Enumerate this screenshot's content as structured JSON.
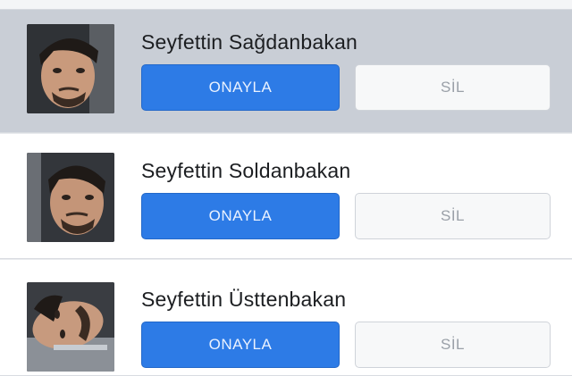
{
  "friend_requests": [
    {
      "name": "Seyfettin Sağdanbakan",
      "confirm_label": "ONAYLA",
      "delete_label": "SİL"
    },
    {
      "name": "Seyfettin Soldanbakan",
      "confirm_label": "ONAYLA",
      "delete_label": "SİL"
    },
    {
      "name": "Seyfettin Üsttenbakan",
      "confirm_label": "ONAYLA",
      "delete_label": "SİL"
    }
  ],
  "colors": {
    "confirm_button": "#2d7be6",
    "delete_button": "#f7f8f9",
    "highlight_row": "#c9ced6",
    "background": "#e9ebee"
  }
}
